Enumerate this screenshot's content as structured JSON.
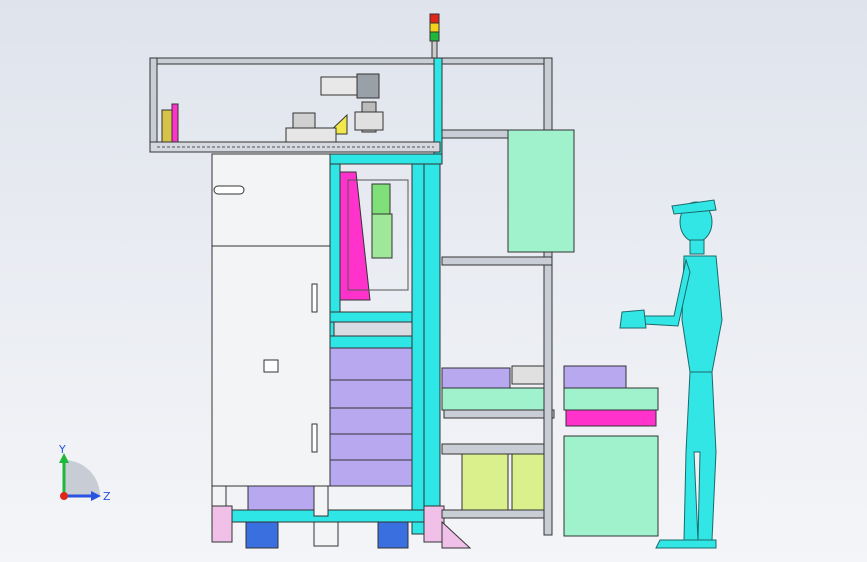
{
  "scene": {
    "description_free": true,
    "background_top": "#dfe3ec",
    "background_bottom": "#f4f5f8",
    "colors": {
      "frame_cyan": "#2ee6e6",
      "frame_grey": "#c9ced6",
      "cabinet_white": "#f3f4f6",
      "magenta": "#ff33cc",
      "lilac": "#b8a8f0",
      "mint": "#9ff2cc",
      "lime": "#d9f08c",
      "light_green": "#7fe07a",
      "blue": "#3a6fe0",
      "signal_red": "#e0261b",
      "signal_yellow": "#f2d21b",
      "signal_green": "#1fb83a",
      "human_cyan": "#33e6e6"
    }
  },
  "axes_triad": {
    "y_label": "Y",
    "z_label": "Z",
    "x_color": "#e0261b",
    "y_color": "#1fb83a",
    "z_color": "#2a52e0"
  }
}
